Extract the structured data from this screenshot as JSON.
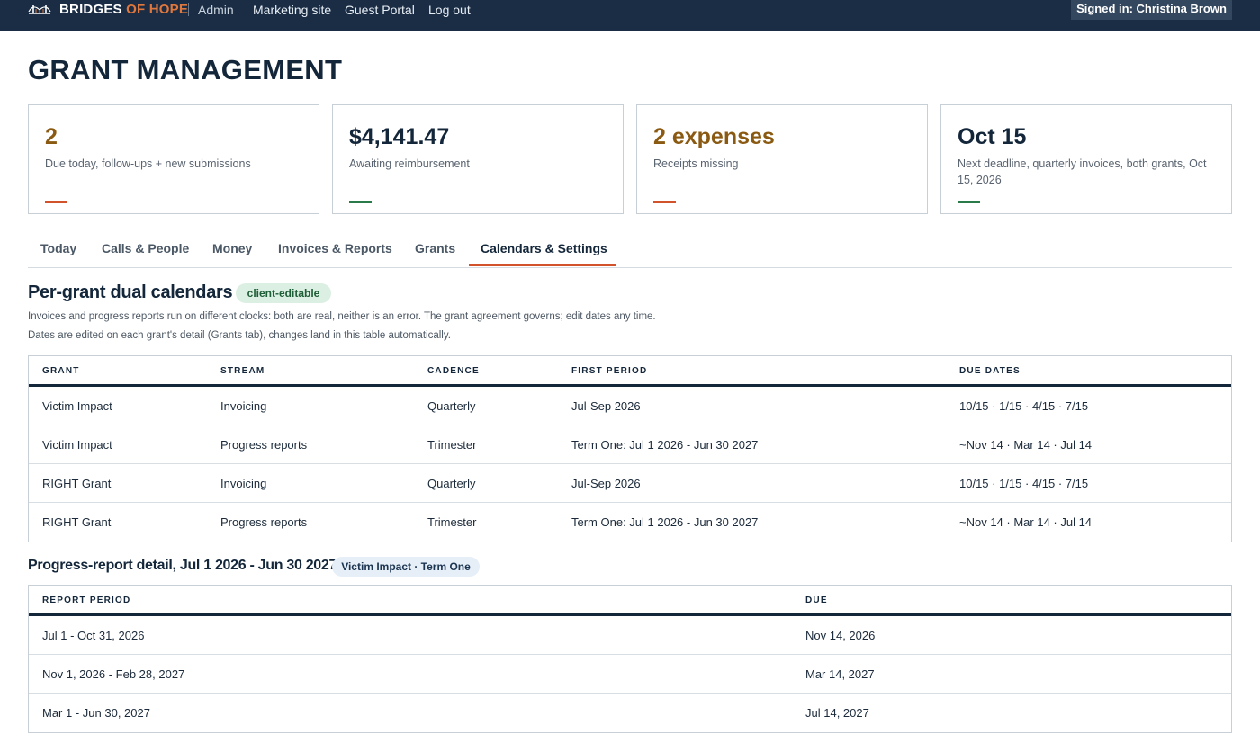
{
  "topbar": {
    "brand_part1": "BRIDGES",
    "brand_part2": " OF HOPE",
    "role": "Admin",
    "links": [
      "Marketing site",
      "Guest Portal",
      "Log out"
    ],
    "signed_in": "Signed in: Christina Brown",
    "logo_icon": "bridge-icon"
  },
  "page": {
    "title": "GRANT MANAGEMENT"
  },
  "cards": [
    {
      "value": "2",
      "label": "Due today, follow-ups + new submissions",
      "value_color": "#8a5a12",
      "accent_color": "#d2532b"
    },
    {
      "value": "$4,141.47",
      "label": "Awaiting reimbursement",
      "value_color": "#13263a",
      "accent_color": "#2a7a4a"
    },
    {
      "value": "2 expenses",
      "label": "Receipts missing",
      "value_color": "#8a5a12",
      "accent_color": "#d2532b"
    },
    {
      "value": "Oct 15",
      "label": "Next deadline, quarterly invoices, both grants, Oct 15, 2026",
      "value_color": "#13263a",
      "accent_color": "#2a7a4a"
    }
  ],
  "tabs": [
    {
      "label": "Today"
    },
    {
      "label": "Calls & People"
    },
    {
      "label": "Money"
    },
    {
      "label": "Invoices & Reports"
    },
    {
      "label": "Grants"
    },
    {
      "label": "Calendars & Settings",
      "active": true
    }
  ],
  "calendars": {
    "title": "Per-grant dual calendars",
    "badge": "client-editable",
    "desc1": "Invoices and progress reports run on different clocks: both are real, neither is an error. The grant agreement governs; edit dates any time.",
    "desc2": "Dates are edited on each grant's detail (Grants tab), changes land in this table automatically.",
    "columns": [
      "GRANT",
      "STREAM",
      "CADENCE",
      "FIRST PERIOD",
      "DUE DATES"
    ],
    "rows": [
      [
        "Victim Impact",
        "Invoicing",
        "Quarterly",
        "Jul-Sep 2026",
        "10/15 · 1/15 · 4/15 · 7/15"
      ],
      [
        "Victim Impact",
        "Progress reports",
        "Trimester",
        "Term One: Jul 1 2026 - Jun 30 2027",
        "~Nov 14 · Mar 14 · Jul 14"
      ],
      [
        "RIGHT Grant",
        "Invoicing",
        "Quarterly",
        "Jul-Sep 2026",
        "10/15 · 1/15 · 4/15 · 7/15"
      ],
      [
        "RIGHT Grant",
        "Progress reports",
        "Trimester",
        "Term One: Jul 1 2026 - Jun 30 2027",
        "~Nov 14 · Mar 14 · Jul 14"
      ]
    ]
  },
  "detail": {
    "title": "Progress-report detail, Jul 1 2026 - Jun 30 2027",
    "badge": "Victim Impact · Term One",
    "columns": [
      "REPORT PERIOD",
      "DUE"
    ],
    "rows": [
      [
        "Jul 1 - Oct 31, 2026",
        "Nov 14, 2026"
      ],
      [
        "Nov 1, 2026 - Feb 28, 2027",
        "Mar 14, 2027"
      ],
      [
        "Mar 1 - Jun 30, 2027",
        "Jul 14, 2027"
      ]
    ]
  }
}
